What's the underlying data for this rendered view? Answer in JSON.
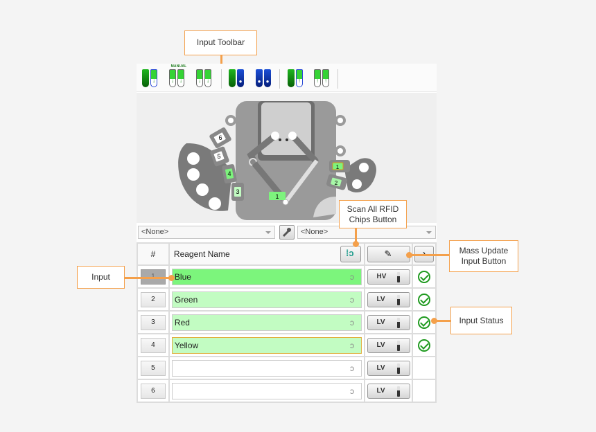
{
  "callouts": {
    "input_toolbar": "Input Toolbar",
    "scan_rfid": "Scan All RFID Chips Button",
    "scan_rfid_line1": "Scan All RFID",
    "scan_rfid_line2": "Chips Button",
    "mass_update_line1": "Mass Update",
    "mass_update_line2": "Input Button",
    "input": "Input",
    "input_status": "Input Status"
  },
  "toolbar": {
    "manual_label": "MANUAL",
    "buttons": [
      "load-single",
      "load-manual",
      "load-double",
      "prime-single",
      "prime-double",
      "unload-single",
      "unload-double"
    ]
  },
  "deck": {
    "left_positions": [
      "6",
      "5",
      "4",
      "3"
    ],
    "right_positions": [
      "1",
      "2"
    ],
    "center_position": "1"
  },
  "dropdowns": {
    "left_value": "<None>",
    "right_value": "<None>"
  },
  "grid": {
    "headers": {
      "number": "#",
      "name": "Reagent Name"
    },
    "rows": [
      {
        "num": "1",
        "name": "Blue",
        "voltage": "HV",
        "status": "ok",
        "fill": "#7cf57c",
        "selected": true
      },
      {
        "num": "2",
        "name": "Green",
        "voltage": "LV",
        "status": "ok",
        "fill": "#c2fcc2",
        "selected": false
      },
      {
        "num": "3",
        "name": "Red",
        "voltage": "LV",
        "status": "ok",
        "fill": "#c2fcc2",
        "selected": false
      },
      {
        "num": "4",
        "name": "Yellow",
        "voltage": "LV",
        "status": "ok",
        "fill": "#c2fcc2",
        "selected": false
      },
      {
        "num": "5",
        "name": "",
        "voltage": "LV",
        "status": "",
        "fill": "#ffffff",
        "selected": false
      },
      {
        "num": "6",
        "name": "",
        "voltage": "LV",
        "status": "",
        "fill": "#ffffff",
        "selected": false
      }
    ]
  },
  "colors": {
    "accent": "#f4a04b",
    "status_ok": "#1f9a1f"
  }
}
